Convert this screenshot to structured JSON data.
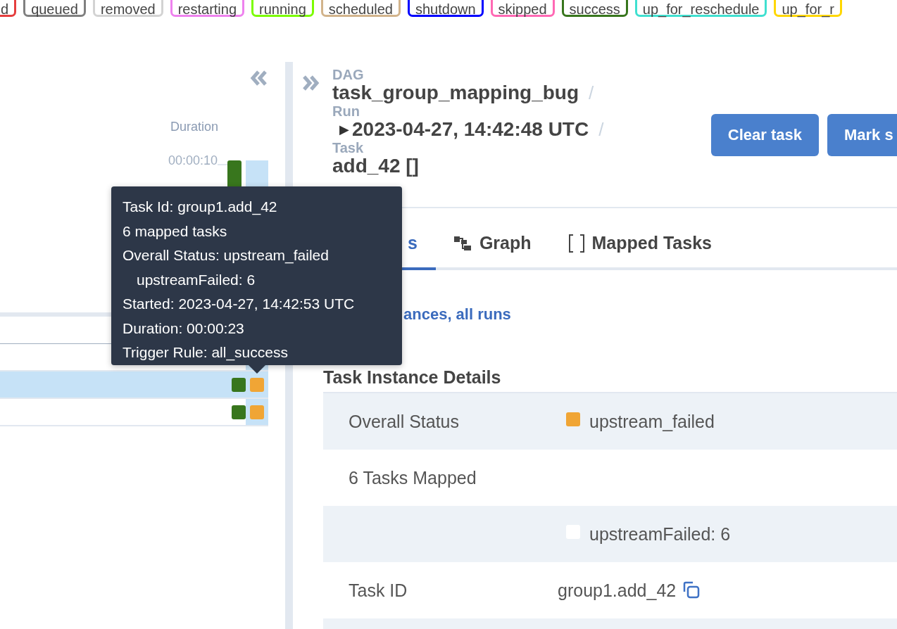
{
  "legend": [
    {
      "label": "d",
      "color": "#e53e3e"
    },
    {
      "label": "queued",
      "color": "#808080"
    },
    {
      "label": "removed",
      "color": "#d3d3d3"
    },
    {
      "label": "restarting",
      "color": "#ee82ee"
    },
    {
      "label": "running",
      "color": "#7cfc00"
    },
    {
      "label": "scheduled",
      "color": "#d2b48c"
    },
    {
      "label": "shutdown",
      "color": "#0000ff"
    },
    {
      "label": "skipped",
      "color": "#ff69b4"
    },
    {
      "label": "success",
      "color": "#38761d"
    },
    {
      "label": "up_for_reschedule",
      "color": "#40e0d0"
    },
    {
      "label": "up_for_r",
      "color": "#ffd700"
    }
  ],
  "grid": {
    "duration_header": "Duration",
    "duration_tick": "00:00:10",
    "rows": [
      {
        "selected": false
      },
      {
        "selected": false
      },
      {
        "selected": true,
        "statuses": [
          {
            "color": "#38761d"
          },
          {
            "color": "#f0a535"
          }
        ]
      },
      {
        "selected": false,
        "statuses": [
          {
            "color": "#38761d"
          },
          {
            "color": "#f0a535"
          }
        ]
      }
    ]
  },
  "tooltip": {
    "lines": [
      {
        "kind": "line",
        "text": "Task Id: group1.add_42"
      },
      {
        "kind": "line",
        "text": "6 mapped tasks"
      },
      {
        "kind": "line",
        "text": "Overall Status: upstream_failed"
      },
      {
        "kind": "sub",
        "text": "upstreamFailed: 6"
      },
      {
        "kind": "line",
        "text": "Started: 2023-04-27, 14:42:53 UTC"
      },
      {
        "kind": "line",
        "text": "Duration: 00:00:23"
      },
      {
        "kind": "line",
        "text": "Trigger Rule: all_success"
      }
    ]
  },
  "breadcrumbs": [
    {
      "label": "DAG",
      "value": "task_group_mapping_bug",
      "separator": "/"
    },
    {
      "label": "Run",
      "value": "2023-04-27, 14:42:48 UTC",
      "separator": "/",
      "expander": "▶"
    },
    {
      "label": "Task",
      "value": "add_42 []"
    }
  ],
  "buttons": [
    "Clear task",
    "Mark s"
  ],
  "tabs": [
    {
      "label": "s",
      "selected": true,
      "kind": "plain"
    },
    {
      "label": "Graph",
      "selected": false,
      "kind": "graph"
    },
    {
      "label": "Mapped Tasks",
      "selected": false,
      "kind": "brackets"
    }
  ],
  "link": "ances, all runs",
  "details": {
    "title": "Task Instance Details",
    "rows": [
      {
        "label": "Overall Status",
        "value": "upstream_failed",
        "color": "#f0a535"
      },
      {
        "label": "6 Tasks Mapped"
      },
      {
        "value": "upstreamFailed: 6",
        "color": "#ffffff"
      },
      {
        "label": "Task ID",
        "value": "group1.add_42",
        "copy": true
      }
    ]
  }
}
